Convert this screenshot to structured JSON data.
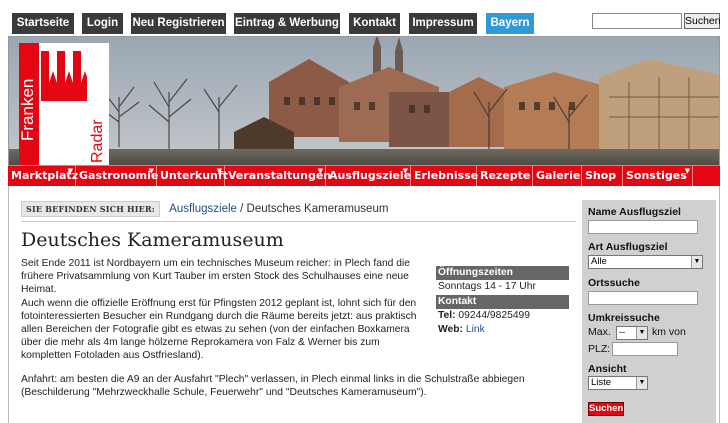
{
  "topnav": {
    "items": [
      {
        "label": "Startseite"
      },
      {
        "label": "Login"
      },
      {
        "label": "Neu Registrieren"
      },
      {
        "label": "Eintrag & Werbung"
      },
      {
        "label": "Kontakt"
      },
      {
        "label": "Impressum"
      },
      {
        "label": "Bayern",
        "active": true
      }
    ],
    "search_button": "Suchen",
    "active_color": "#2f9ad8",
    "bar_color": "#3a3a3a"
  },
  "logo": {
    "line1": "Franken",
    "line2": "Radar",
    "brand_color": "#e30613"
  },
  "rednav": {
    "items": [
      {
        "label": "Marktplatz",
        "dropdown": true
      },
      {
        "label": "Gastronomie",
        "dropdown": true
      },
      {
        "label": "Unterkunft",
        "dropdown": true
      },
      {
        "label": "Veranstaltungen",
        "dropdown": true
      },
      {
        "label": "Ausflugsziele",
        "dropdown": true
      },
      {
        "label": "Erlebnisse",
        "dropdown": false
      },
      {
        "label": "Rezepte",
        "dropdown": false
      },
      {
        "label": "Galerie",
        "dropdown": false
      },
      {
        "label": "Shop",
        "dropdown": false
      },
      {
        "label": "Sonstiges",
        "dropdown": true
      }
    ]
  },
  "breadcrumb": {
    "label": "SIE BEFINDEN SICH HIER:",
    "link": "Ausflugsziele",
    "separator": " / ",
    "current": "Deutsches Kameramuseum"
  },
  "article": {
    "title": "Deutsches Kameramuseum",
    "p1": "Seit Ende 2011 ist Nordbayern um ein technisches Museum reicher: in Plech fand die frühere Privatsammlung von Kurt Tauber im ersten Stock des Schulhauses eine neue Heimat.",
    "p1b": "Auch wenn die offizielle Eröffnung erst für Pfingsten 2012 geplant ist, lohnt sich für den fotointeressierten Besucher ein Rundgang durch die Räume bereits jetzt: aus praktisch allen Bereichen der Fotografie gibt es etwas zu sehen (von der einfachen Boxkamera über die mehr als 4m lange hölzerne Reprokamera von Falz & Werner bis zum kompletten Fotoladen aus Ostfriesland).",
    "p2": "Anfahrt: am besten die A9 an der Ausfahrt \"Plech\" verlassen, in Plech einmal links in die Schulstraße abbiegen (Beschilderung \"Mehrzweckhalle Schule, Feuerwehr\" und \"Deutsches Kameramuseum\")."
  },
  "infobox": {
    "hours_title": "Öffnungszeiten",
    "hours": "Sonntags 14 - 17 Uhr",
    "contact_title": "Kontakt",
    "tel_label": "Tel:",
    "tel": "09244/9825499",
    "web_label": "Web:",
    "web_link": "Link"
  },
  "sidebar": {
    "name_label": "Name Ausflugsziel",
    "type_label": "Art Ausflugsziel",
    "type_value": "Alle",
    "place_label": "Ortssuche",
    "radius_label": "Umkreissuche",
    "max_label": "Max.",
    "max_value": "--",
    "km_label": "km von",
    "plz_label": "PLZ:",
    "view_label": "Ansicht",
    "view_value": "Liste",
    "submit": "Suchen"
  }
}
